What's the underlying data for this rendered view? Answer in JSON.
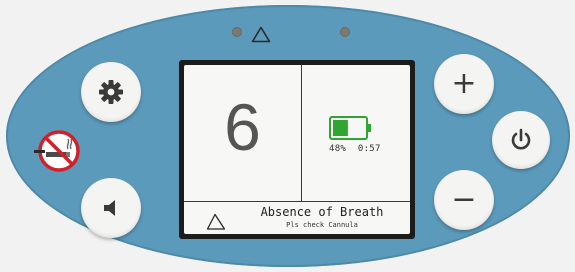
{
  "display": {
    "main_value": "6",
    "battery_percent": 48,
    "battery_text": "48%",
    "battery_time": "0:57",
    "alarm_title": "Absence of Breath",
    "alarm_subtitle": "Pls check Cannula"
  },
  "controls": {
    "settings_icon": "gear-icon",
    "volume_icon": "speaker-icon",
    "plus_label": "+",
    "minus_label": "−",
    "power_icon": "power-icon"
  },
  "colors": {
    "panel": "#5b9aba",
    "battery_fill": "#2fa532",
    "warning_red": "#d0202a"
  }
}
